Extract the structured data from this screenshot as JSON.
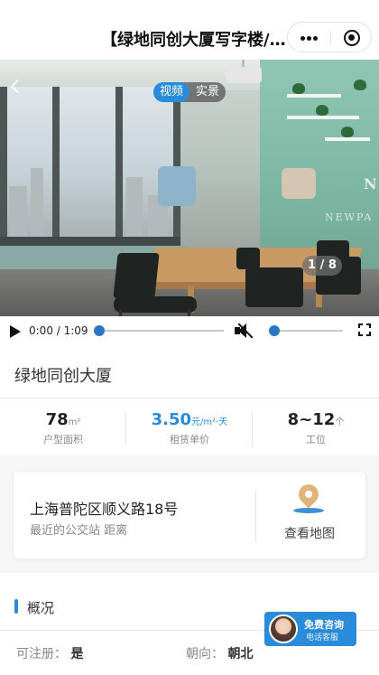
{
  "header": {
    "title": "【绿地同创大厦写字楼/…"
  },
  "media": {
    "tabs": [
      {
        "label": "视频",
        "active": true
      },
      {
        "label": "实景",
        "active": false
      }
    ],
    "counter": "1 / 8",
    "time": "0:00 / 1:09",
    "wall_text": "NEWPA",
    "progress_fraction": 0,
    "volume_fraction": 0
  },
  "building": {
    "name": "绿地同创大厦"
  },
  "stats": [
    {
      "value": "78",
      "unit": "m²",
      "label": "户型面积"
    },
    {
      "value": "3.50",
      "unit": "元/m²·天",
      "label": "租赁单价"
    },
    {
      "value": "8~12",
      "unit": "个",
      "label": "工位"
    }
  ],
  "location": {
    "address": "上海普陀区顺义路18号",
    "transit": "最近的公交站 距离",
    "map_label": "查看地图"
  },
  "overview": {
    "title": "概况",
    "rows": [
      {
        "label": "可注册：",
        "value": "是"
      },
      {
        "label": "朝向：",
        "value": "朝北"
      }
    ]
  },
  "consult": {
    "main": "免费咨询",
    "sub": "电话客服"
  },
  "colors": {
    "accent": "#2a8bdb"
  }
}
